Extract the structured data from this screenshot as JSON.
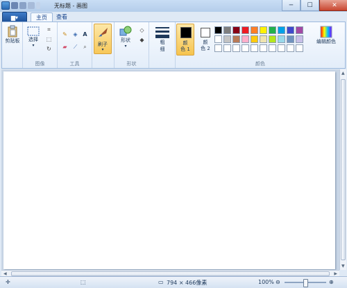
{
  "titlebar": {
    "title": "无标题 - 画图",
    "minimize": "─",
    "maximize": "☐",
    "close": "✕"
  },
  "tabs": {
    "menu_button": "▆▾",
    "home": "主页",
    "view": "查看"
  },
  "clipboard": {
    "paste_label": "剪贴板",
    "group_label": ""
  },
  "image": {
    "select_label": "选择",
    "group_label": "图像"
  },
  "tools": {
    "group_label": "工具",
    "text_tool": "A"
  },
  "brushes": {
    "label": "刷子"
  },
  "shapes": {
    "label": "形状",
    "group_label": "形状"
  },
  "size": {
    "label_line1": "粗",
    "label_line2": "细"
  },
  "colors": {
    "color1_line1": "颜",
    "color1_line2": "色 1",
    "color2_line1": "颜",
    "color2_line2": "色 2",
    "edit_label": "编辑颜色",
    "group_label": "颜色",
    "color1": "#000000",
    "color2": "#ffffff",
    "row1": [
      "#000000",
      "#7f7f7f",
      "#880015",
      "#ed1c24",
      "#ff7f27",
      "#fff200",
      "#22b14c",
      "#00a2e8",
      "#3f48cc",
      "#a349a4"
    ],
    "row2": [
      "#ffffff",
      "#c3c3c3",
      "#b97a57",
      "#ffaec9",
      "#ffc90e",
      "#efe4b0",
      "#b5e61d",
      "#99d9ea",
      "#7092be",
      "#c8bfe7"
    ],
    "row3": [
      "#ffffff",
      "#ffffff",
      "#ffffff",
      "#ffffff",
      "#ffffff",
      "#ffffff",
      "#ffffff",
      "#ffffff",
      "#ffffff",
      "#ffffff"
    ]
  },
  "status": {
    "dimensions": "794 × 466像素",
    "zoom": "100%",
    "zoom_out": "⊖",
    "zoom_in": "⊕"
  }
}
